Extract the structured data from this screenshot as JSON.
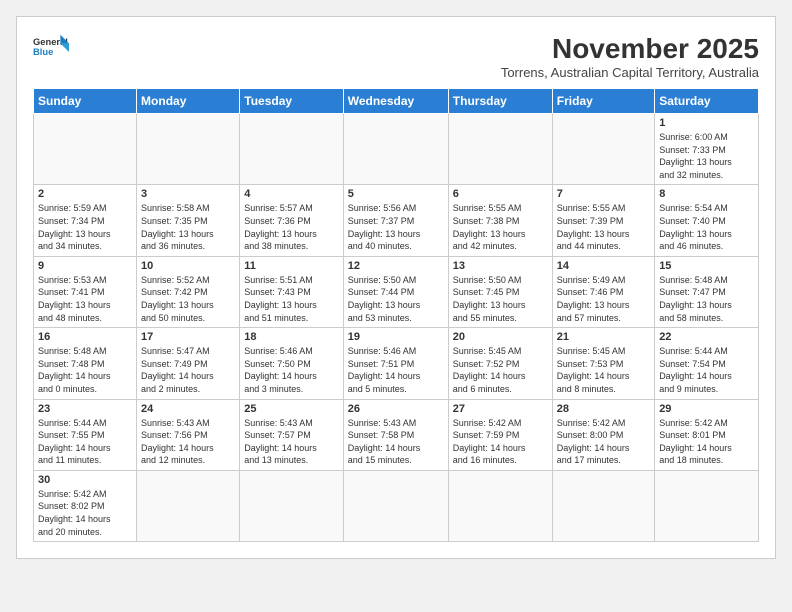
{
  "header": {
    "logo_general": "General",
    "logo_blue": "Blue",
    "month_title": "November 2025",
    "location": "Torrens, Australian Capital Territory, Australia"
  },
  "weekdays": [
    "Sunday",
    "Monday",
    "Tuesday",
    "Wednesday",
    "Thursday",
    "Friday",
    "Saturday"
  ],
  "weeks": [
    [
      {
        "day": "",
        "info": ""
      },
      {
        "day": "",
        "info": ""
      },
      {
        "day": "",
        "info": ""
      },
      {
        "day": "",
        "info": ""
      },
      {
        "day": "",
        "info": ""
      },
      {
        "day": "",
        "info": ""
      },
      {
        "day": "1",
        "info": "Sunrise: 6:00 AM\nSunset: 7:33 PM\nDaylight: 13 hours\nand 32 minutes."
      }
    ],
    [
      {
        "day": "2",
        "info": "Sunrise: 5:59 AM\nSunset: 7:34 PM\nDaylight: 13 hours\nand 34 minutes."
      },
      {
        "day": "3",
        "info": "Sunrise: 5:58 AM\nSunset: 7:35 PM\nDaylight: 13 hours\nand 36 minutes."
      },
      {
        "day": "4",
        "info": "Sunrise: 5:57 AM\nSunset: 7:36 PM\nDaylight: 13 hours\nand 38 minutes."
      },
      {
        "day": "5",
        "info": "Sunrise: 5:56 AM\nSunset: 7:37 PM\nDaylight: 13 hours\nand 40 minutes."
      },
      {
        "day": "6",
        "info": "Sunrise: 5:55 AM\nSunset: 7:38 PM\nDaylight: 13 hours\nand 42 minutes."
      },
      {
        "day": "7",
        "info": "Sunrise: 5:55 AM\nSunset: 7:39 PM\nDaylight: 13 hours\nand 44 minutes."
      },
      {
        "day": "8",
        "info": "Sunrise: 5:54 AM\nSunset: 7:40 PM\nDaylight: 13 hours\nand 46 minutes."
      }
    ],
    [
      {
        "day": "9",
        "info": "Sunrise: 5:53 AM\nSunset: 7:41 PM\nDaylight: 13 hours\nand 48 minutes."
      },
      {
        "day": "10",
        "info": "Sunrise: 5:52 AM\nSunset: 7:42 PM\nDaylight: 13 hours\nand 50 minutes."
      },
      {
        "day": "11",
        "info": "Sunrise: 5:51 AM\nSunset: 7:43 PM\nDaylight: 13 hours\nand 51 minutes."
      },
      {
        "day": "12",
        "info": "Sunrise: 5:50 AM\nSunset: 7:44 PM\nDaylight: 13 hours\nand 53 minutes."
      },
      {
        "day": "13",
        "info": "Sunrise: 5:50 AM\nSunset: 7:45 PM\nDaylight: 13 hours\nand 55 minutes."
      },
      {
        "day": "14",
        "info": "Sunrise: 5:49 AM\nSunset: 7:46 PM\nDaylight: 13 hours\nand 57 minutes."
      },
      {
        "day": "15",
        "info": "Sunrise: 5:48 AM\nSunset: 7:47 PM\nDaylight: 13 hours\nand 58 minutes."
      }
    ],
    [
      {
        "day": "16",
        "info": "Sunrise: 5:48 AM\nSunset: 7:48 PM\nDaylight: 14 hours\nand 0 minutes."
      },
      {
        "day": "17",
        "info": "Sunrise: 5:47 AM\nSunset: 7:49 PM\nDaylight: 14 hours\nand 2 minutes."
      },
      {
        "day": "18",
        "info": "Sunrise: 5:46 AM\nSunset: 7:50 PM\nDaylight: 14 hours\nand 3 minutes."
      },
      {
        "day": "19",
        "info": "Sunrise: 5:46 AM\nSunset: 7:51 PM\nDaylight: 14 hours\nand 5 minutes."
      },
      {
        "day": "20",
        "info": "Sunrise: 5:45 AM\nSunset: 7:52 PM\nDaylight: 14 hours\nand 6 minutes."
      },
      {
        "day": "21",
        "info": "Sunrise: 5:45 AM\nSunset: 7:53 PM\nDaylight: 14 hours\nand 8 minutes."
      },
      {
        "day": "22",
        "info": "Sunrise: 5:44 AM\nSunset: 7:54 PM\nDaylight: 14 hours\nand 9 minutes."
      }
    ],
    [
      {
        "day": "23",
        "info": "Sunrise: 5:44 AM\nSunset: 7:55 PM\nDaylight: 14 hours\nand 11 minutes."
      },
      {
        "day": "24",
        "info": "Sunrise: 5:43 AM\nSunset: 7:56 PM\nDaylight: 14 hours\nand 12 minutes."
      },
      {
        "day": "25",
        "info": "Sunrise: 5:43 AM\nSunset: 7:57 PM\nDaylight: 14 hours\nand 13 minutes."
      },
      {
        "day": "26",
        "info": "Sunrise: 5:43 AM\nSunset: 7:58 PM\nDaylight: 14 hours\nand 15 minutes."
      },
      {
        "day": "27",
        "info": "Sunrise: 5:42 AM\nSunset: 7:59 PM\nDaylight: 14 hours\nand 16 minutes."
      },
      {
        "day": "28",
        "info": "Sunrise: 5:42 AM\nSunset: 8:00 PM\nDaylight: 14 hours\nand 17 minutes."
      },
      {
        "day": "29",
        "info": "Sunrise: 5:42 AM\nSunset: 8:01 PM\nDaylight: 14 hours\nand 18 minutes."
      }
    ],
    [
      {
        "day": "30",
        "info": "Sunrise: 5:42 AM\nSunset: 8:02 PM\nDaylight: 14 hours\nand 20 minutes."
      },
      {
        "day": "",
        "info": ""
      },
      {
        "day": "",
        "info": ""
      },
      {
        "day": "",
        "info": ""
      },
      {
        "day": "",
        "info": ""
      },
      {
        "day": "",
        "info": ""
      },
      {
        "day": "",
        "info": ""
      }
    ]
  ]
}
